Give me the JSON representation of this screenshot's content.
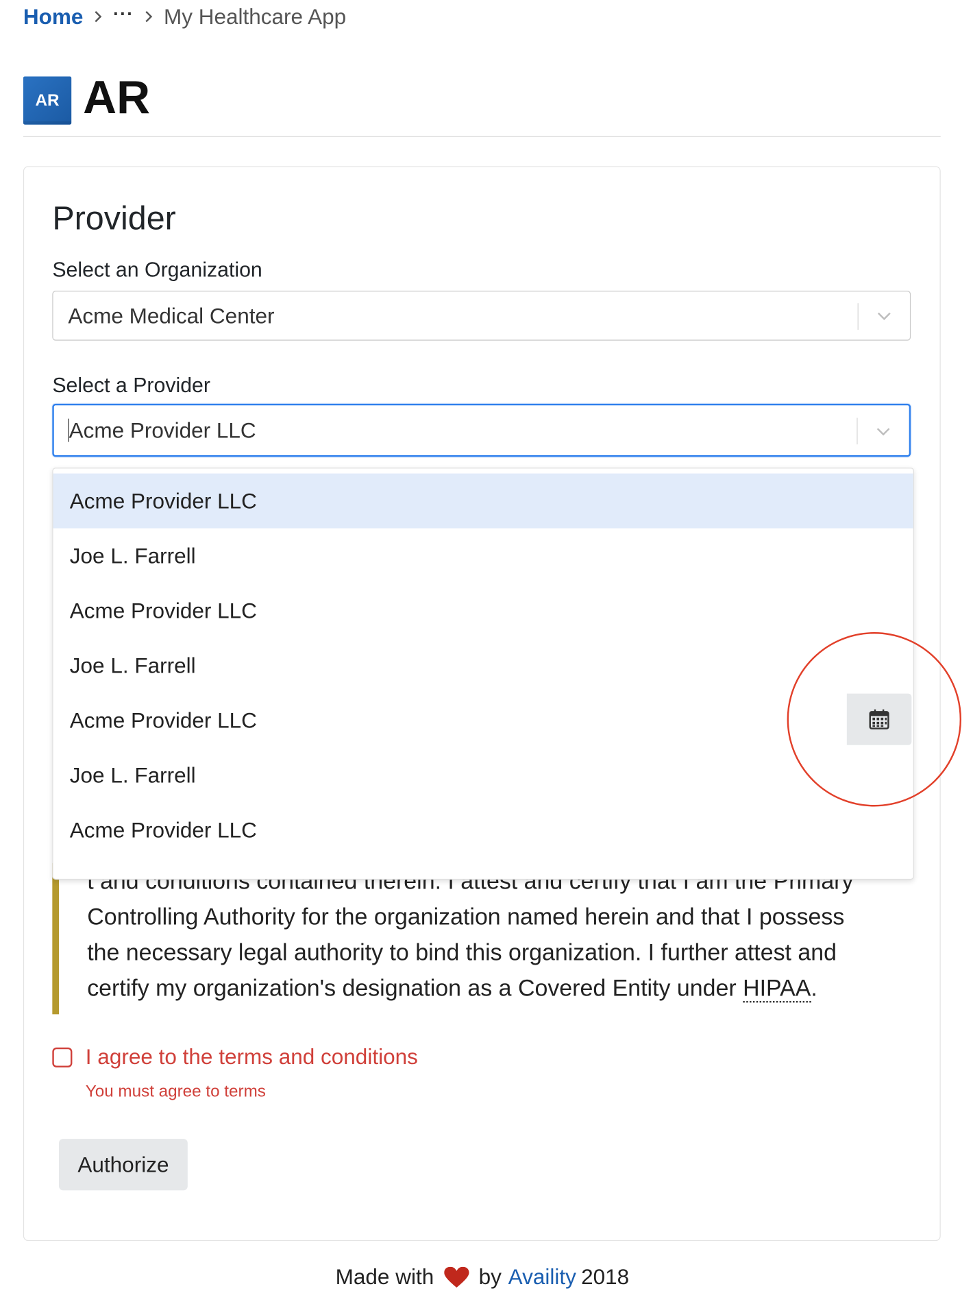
{
  "breadcrumb": {
    "home": "Home",
    "ellipsis": "···",
    "current": "My Healthcare App"
  },
  "header": {
    "icon_text": "AR",
    "title": "AR"
  },
  "card": {
    "title": "Provider",
    "organization": {
      "label": "Select an Organization",
      "value": "Acme Medical Center"
    },
    "provider": {
      "label": "Select a Provider",
      "value": "Acme Provider LLC",
      "options": [
        "Acme Provider LLC",
        "Joe L. Farrell",
        "Acme Provider LLC",
        "Joe L. Farrell",
        "Acme Provider LLC",
        "Joe L. Farrell",
        "Acme Provider LLC"
      ],
      "highlighted_index": 0
    },
    "terms": {
      "partial_line": "t and conditions contained therein. I attest and certify that I am the Primary",
      "line_2": "Controlling Authority for the organization named herein and that I possess",
      "line_3": "the necessary legal authority to bind this organization. I further attest and",
      "line_4_before": "certify my organization's designation as a Covered Entity under ",
      "line_4_abbr": "HIPAA",
      "line_4_after": "."
    },
    "agree": {
      "label": "I agree to the terms and conditions",
      "error": "You must agree to terms"
    },
    "authorize_label": "Authorize"
  },
  "footer": {
    "made_with": "Made with",
    "by": "by",
    "brand": "Availity",
    "year": "2018"
  },
  "colors": {
    "link": "#1a5eb0",
    "error": "#d0403a",
    "focus": "#2f80ed",
    "highlight_circle": "#e2402a",
    "terms_border": "#b59a2e",
    "menu_active": "#e1ebfa"
  },
  "icons": [
    "chevron-right-icon",
    "chevron-down-icon",
    "calendar-icon",
    "heart-icon"
  ]
}
